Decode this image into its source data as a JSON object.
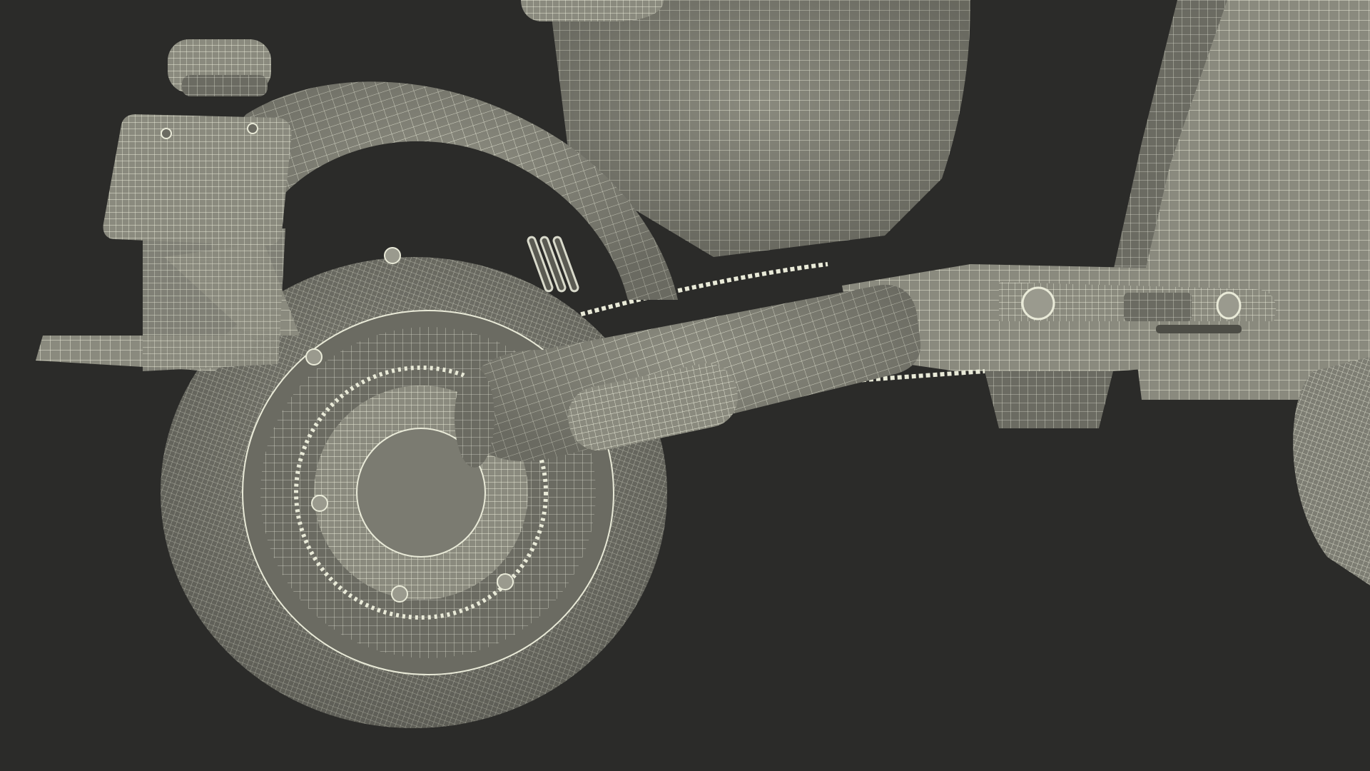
{
  "scene": {
    "subject": "wireframe-render-electric-scooter-rear",
    "colors": {
      "background": "#2b2b29",
      "surface": "#8a8a7e",
      "surface_light": "#a3a396",
      "surface_dark": "#5f5f57",
      "wire": "#e9ead8",
      "tire": "#7d7d73"
    }
  }
}
